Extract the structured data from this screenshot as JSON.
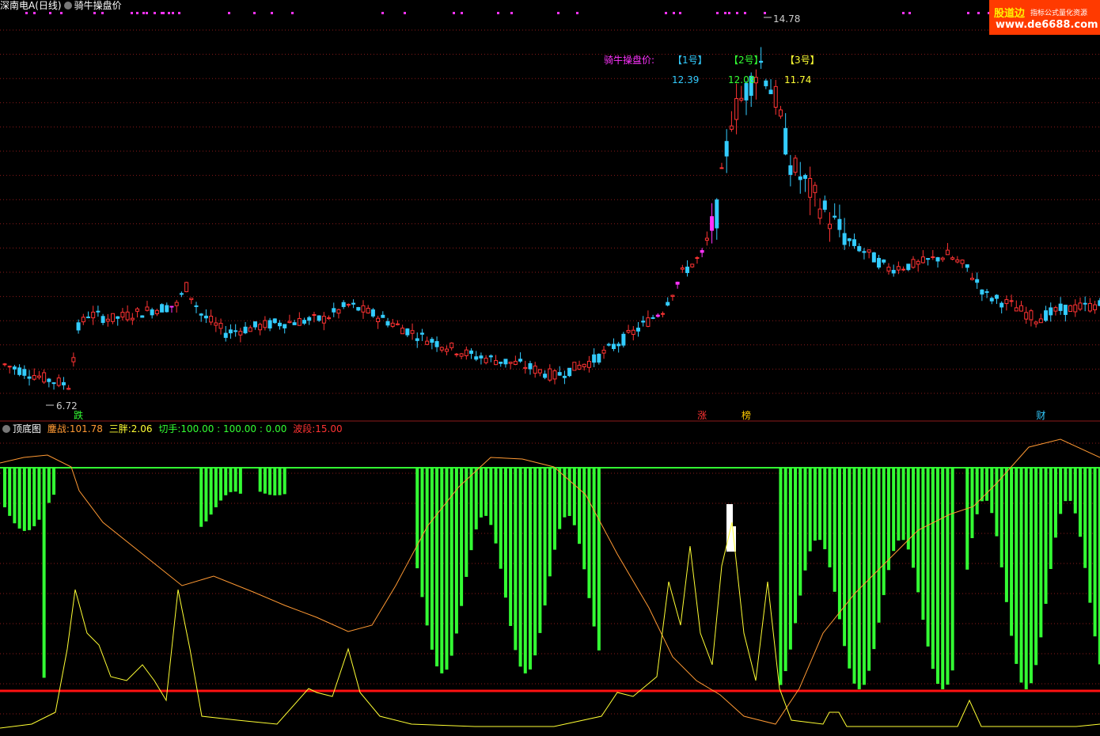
{
  "header": {
    "symbol": "深南电A(日线)",
    "indicator": "骑牛操盘价"
  },
  "watermark": {
    "brand": "股道边",
    "slogan": "指标公式量化资源",
    "url": "www.de6688.com"
  },
  "price_panel": {
    "high_label": "14.78",
    "low_label": "6.72",
    "legend_title": "骑牛操盘价:",
    "slots": [
      {
        "name": "【1号】",
        "value": "12.39",
        "color": "#33ccff"
      },
      {
        "name": "【2号】",
        "value": "12.08",
        "color": "#33ff33"
      },
      {
        "name": "【3号】",
        "value": "11.74",
        "color": "#ffff33"
      }
    ],
    "signals": [
      {
        "label": "跌",
        "bar": 15,
        "color": "#33ff33"
      },
      {
        "label": "涨",
        "bar": 142,
        "color": "#ff3333"
      },
      {
        "label": "榜",
        "bar": 151,
        "color": "#ffcc00"
      },
      {
        "label": "财",
        "bar": 211,
        "color": "#33ccff"
      }
    ]
  },
  "oscillator_panel": {
    "title": "顶底图",
    "fields": [
      {
        "name": "鏖战:",
        "value": "101.78",
        "color": "#ff9933"
      },
      {
        "name": "三胖:",
        "value": "2.06",
        "color": "#ffff33"
      },
      {
        "name": "切手:",
        "value": "100.00 : 100.00 : 0.00",
        "color": "#33ff33"
      },
      {
        "name": "波段:",
        "value": "15.00",
        "color": "#ff3333"
      }
    ]
  },
  "colors": {
    "up": "#ff3333",
    "down": "#33ccff",
    "magenta": "#ff33ff",
    "green": "#33ff33",
    "grid": "#8b1a1a",
    "orange_line": "#ff9933",
    "yellow_line": "#ffff33",
    "red_line": "#ff1111"
  },
  "chart_data": {
    "type": "candlestick",
    "ylim": [
      6.0,
      15.0
    ],
    "low_price": 6.72,
    "high_price": 14.78
  }
}
